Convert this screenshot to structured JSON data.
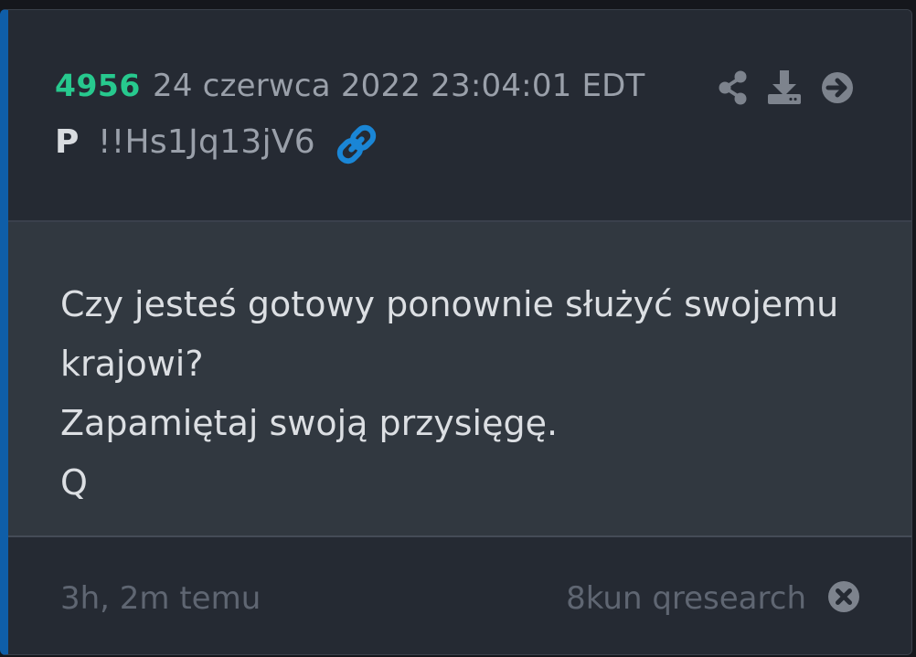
{
  "post": {
    "number": "4956",
    "date": "24 czerwca 2022 23:04:01 EDT",
    "author": "P",
    "tripcode": "!!Hs1Jq13jV6"
  },
  "message": {
    "lines": [
      "Czy jesteś gotowy ponownie służyć swojemu",
      "krajowi?",
      "Zapamiętaj swoją przysięgę.",
      "Q"
    ]
  },
  "footer": {
    "elapsed": "3h, 2m temu",
    "source": "8kun qresearch"
  },
  "icons": {
    "link": "link-icon",
    "share": "share-icon",
    "download": "download-icon",
    "open": "arrow-right-circle-icon",
    "close": "close-circle-icon"
  },
  "colors": {
    "accent_bar": "#0f5ea8",
    "post_number": "#27c98e",
    "link_icon": "#1a86d6",
    "card_bg": "#252a33",
    "body_bg": "#313840"
  }
}
